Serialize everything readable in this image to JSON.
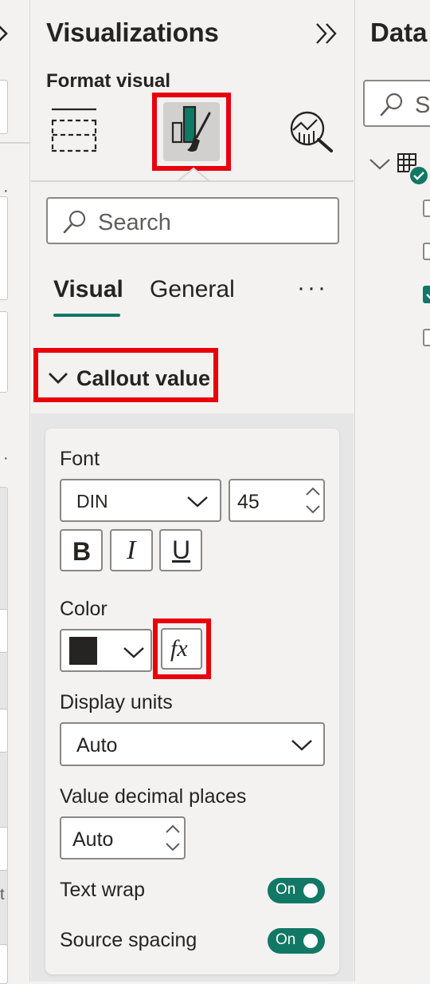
{
  "left_pane": {
    "overflow_dots": [
      "·",
      "·"
    ],
    "partial_text": "t"
  },
  "visualizations": {
    "title": "Visualizations",
    "section_label": "Format visual",
    "icons": [
      "build-visual-icon",
      "format-paintbrush-icon",
      "analytics-icon"
    ],
    "search": {
      "placeholder": "Search"
    },
    "tabs": [
      {
        "label": "Visual",
        "active": true
      },
      {
        "label": "General",
        "active": false
      }
    ],
    "more_label": "···",
    "section": {
      "title": "Callout value",
      "font": {
        "label": "Font",
        "family": "DIN",
        "size": "45",
        "bold": "B",
        "italic": "I",
        "underline": "U"
      },
      "color": {
        "label": "Color",
        "swatch": "#252423",
        "fx": "fx"
      },
      "display_units": {
        "label": "Display units",
        "value": "Auto"
      },
      "decimal_places": {
        "label": "Value decimal places",
        "value": "Auto"
      },
      "text_wrap": {
        "label": "Text wrap",
        "state": "On"
      },
      "source_spacing": {
        "label": "Source spacing",
        "state": "On"
      }
    }
  },
  "data_pane": {
    "title": "Data",
    "search_placeholder": "Search",
    "fields": [
      {
        "checked": false
      },
      {
        "checked": false
      },
      {
        "checked": true
      },
      {
        "checked": false
      }
    ]
  },
  "colors": {
    "accent": "#117865",
    "highlight": "#e8000b",
    "pane_bg": "#f3f2f1"
  }
}
